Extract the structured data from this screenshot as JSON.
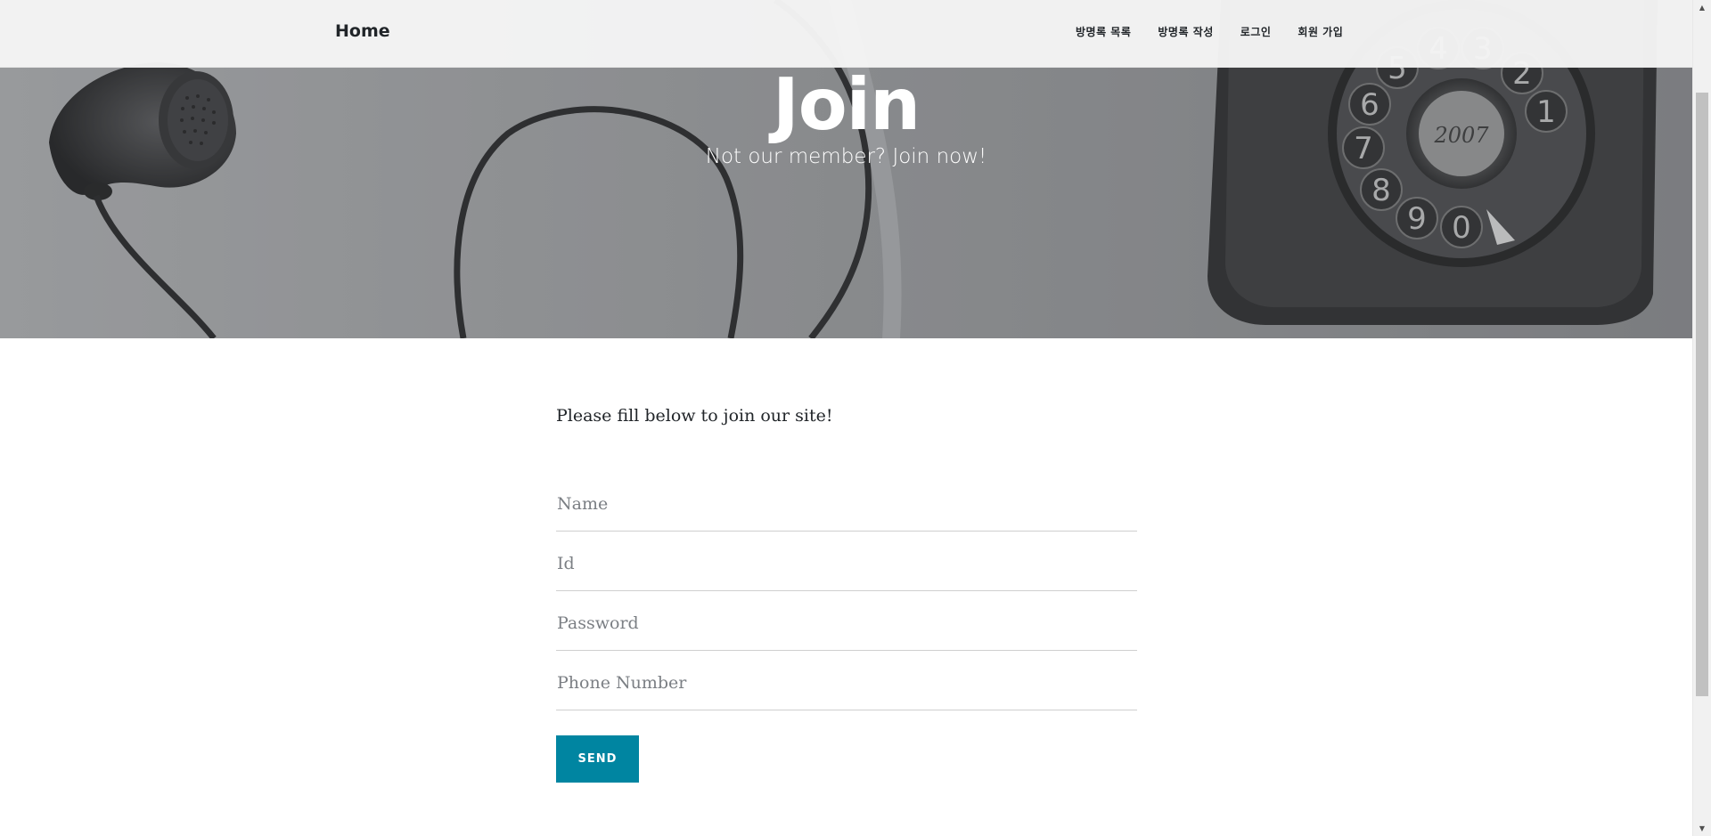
{
  "nav": {
    "brand": "Home",
    "links": [
      "방명록 목록",
      "방명록 작성",
      "로그인",
      "회원 가입"
    ]
  },
  "hero": {
    "title": "Join",
    "subtitle": "Not our member? Join now!"
  },
  "form": {
    "intro": "Please fill below to join our site!",
    "name_placeholder": "Name",
    "id_placeholder": "Id",
    "password_placeholder": "Password",
    "phone_placeholder": "Phone Number",
    "send_label": "SEND"
  },
  "dial_digits": [
    "1",
    "2",
    "3",
    "4",
    "5",
    "6",
    "7",
    "8",
    "9",
    "0"
  ],
  "dial_center_text": "2007",
  "colors": {
    "accent": "#0085a1",
    "nav_bg": "#f5f5f5",
    "text": "#212529"
  },
  "scrollbar": {
    "up_icon": "scroll-up-arrow-icon",
    "down_icon": "scroll-down-arrow-icon"
  }
}
